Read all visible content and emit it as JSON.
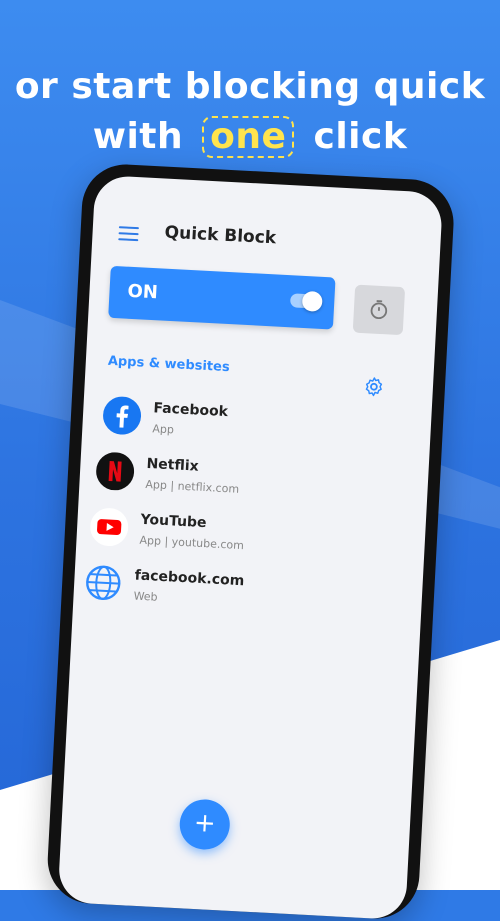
{
  "headline": {
    "line1": "or start blocking quick",
    "line2_prefix": "with",
    "highlight": "one",
    "line2_suffix": "click"
  },
  "colors": {
    "accent": "#2f8bff",
    "highlight": "#ffe44d",
    "background": "#2f7ae6"
  },
  "app": {
    "title": "Quick Block",
    "status_label": "ON",
    "toggle_on": true,
    "section_title": "Apps & websites",
    "items": [
      {
        "name": "Facebook",
        "sub": "App",
        "icon": "facebook-icon"
      },
      {
        "name": "Netflix",
        "sub": "App | netflix.com",
        "icon": "netflix-icon"
      },
      {
        "name": "YouTube",
        "sub": "App | youtube.com",
        "icon": "youtube-icon"
      },
      {
        "name": "facebook.com",
        "sub": "Web",
        "icon": "globe-icon"
      }
    ],
    "fab_label": "+"
  }
}
